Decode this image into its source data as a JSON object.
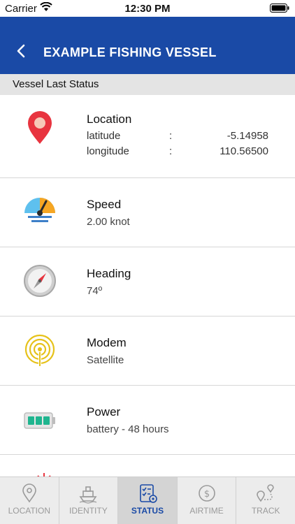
{
  "status_bar": {
    "carrier": "Carrier",
    "time": "12:30 PM"
  },
  "nav": {
    "title": "EXAMPLE FISHING VESSEL"
  },
  "section": {
    "header": "Vessel Last Status"
  },
  "location": {
    "title": "Location",
    "rows": [
      {
        "key": "latitude",
        "sep": ":",
        "value": "-5.14958"
      },
      {
        "key": "longitude",
        "sep": ":",
        "value": "110.56500"
      }
    ]
  },
  "speed": {
    "title": "Speed",
    "value": "2.00 knot"
  },
  "heading": {
    "title": "Heading",
    "value": "74º"
  },
  "modem": {
    "title": "Modem",
    "value": "Satellite"
  },
  "power": {
    "title": "Power",
    "value": "battery - 48 hours"
  },
  "tabs": [
    {
      "label": "LOCATION",
      "icon": "location-icon"
    },
    {
      "label": "IDENTITY",
      "icon": "ship-icon"
    },
    {
      "label": "STATUS",
      "icon": "status-checklist-icon",
      "active": true
    },
    {
      "label": "AIRTIME",
      "icon": "airtime-icon"
    },
    {
      "label": "TRACK",
      "icon": "track-icon"
    }
  ],
  "colors": {
    "nav": "#1a4aa6",
    "pin": "#e8343f",
    "battery": "#1fb58f",
    "modem": "#e6c21a"
  }
}
